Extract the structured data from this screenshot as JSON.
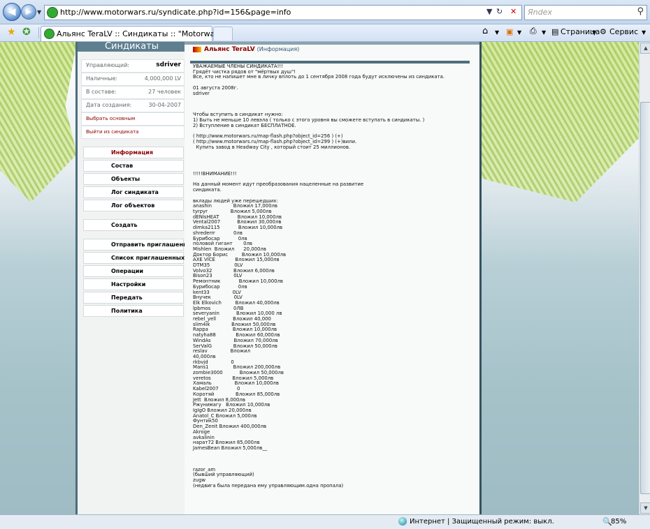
{
  "browser": {
    "url": "http://www.motorwars.ru/syndicate.php?id=156&page=info",
    "search_placeholder": "Яndex",
    "tab_title": "Альянс TeraLV :: Синдикаты :: \"Motorwars\"",
    "page_menu": "Страница",
    "tools_menu": "Сервис",
    "status_zone": "Интернет | Защищенный режим: выкл.",
    "zoom": "85%"
  },
  "sidebar": {
    "title": "Синдикаты",
    "info": [
      {
        "key": "Управляющий:",
        "value": "sdriver"
      },
      {
        "key": "Наличные:",
        "value": "4,000,000 LV"
      },
      {
        "key": "В составе:",
        "value": "27 человек"
      },
      {
        "key": "Дата создания:",
        "value": "30-04-2007"
      }
    ],
    "links": [
      "Выбрать основным",
      "Выйти из синдиката"
    ],
    "menu": [
      "Информация",
      "Состав",
      "Объекты",
      "Лог синдиката",
      "Лог объектов",
      "Создать",
      "Отправить приглашение",
      "Список приглашенных",
      "Операции",
      "Настройки",
      "Передать",
      "Политика"
    ]
  },
  "content": {
    "title": "Альянс TeraLV",
    "subtitle": "(Информация)",
    "text": "УВАЖАЕМЫЕ ЧЛЕНЫ СИНДИКАТА!!!\nГрядёт чистка рядов от \"мёртвых душ\"!\nВсе, кто не напишет мне в личку вплоть до 1 сентября 2008 года будут исключены из синдиката.\n\n01 августа 2008г.\nsdriver\n\n\n\nЧтобы вступить в синдикат нужно:\n1) Быть не меньше 10 левэла ( только с этого уровня вы сможете вступать в синдикаты. )\n2) Вступление в синдикат БЕСПЛАТНОЕ.\n\n( http://www.motorwars.ru/map-flash.php?object_id=256 ) (+)\n( http://www.motorwars.ru/map-flash.php?object_id=299 ) (+)вили.\n  Купить завод в Headway City , который стоит 25 миллионов.\n\n\n\n\n!!!!!ВНИМАНИЕ!!!\n\nНа данный момент идут преобразования нацеленные на развитие\nсиндиката.\n\nвклады людей уже перешедших:\nanashin              Вложил 17,000лв\ntyrpyr               Вложил 5,000лв\ndENIsHEAT            Вложил 10,000лв\nVental2007           Вложил 30,000лв\ndimka2115            Вложил 10,000лв\nshrederrr            0лв\nБурибосар            0лв\nполовой гигант       0лв\nMishlen  Вложил      20,000лв\nДоктор Борис         Вложил 10,000лв\nAXE VICE             Вложил 15,000лв\nDTM35                0LV\nVolvo32              Вложил 6,000лв\nBison23              0LV\nРемонтник            Вложил 10,000лв\nБурибосар            0лв\nkent33               0LV\nВнучек               0LV\nElk Elkovich         Вложил 40,000лв\nlpbmos               0ЛВ\nseveryanin           Вложил 10,000 лв\nrebel_yell           Вложил 40,000\nslim4ik              Вложил 50,000лв\nRappa                Вложил 10,000лв\nnatyha88             Вложил 60,000лв\nWindAs               Вложил 70,000лв\nSerValG              Вложил 50,000лв\nreslav               Вложил\n40,000лв\nrkbvjd               0\nMans1                Вложил 200,000лв\nzombie3000           Вложил 50,000лв\nveretos              Вложил 5,000лв\nХамаль               Вложил 10,000лв\nKabel2007            0\nКоротяй              Вложил 85,000лв\nJett  Вложил 8,000лв\nРжунимагу   Вложил 10,000лв\nIgIgO Вложил 20,000лв\nAnatol_C Вложил 5,000лв\nФунтик50\nDen_Zenit Вложил 400,000лв\nAkroge\navkalinin\nнарат72 Вложил 85,000лв\nJamesBean Вложил 5,000лв__\n\n\n\nrazor_am\n(бывший управляющий)\nzugw\n(недвига была передана ему управляющим.одна пропала)"
  }
}
